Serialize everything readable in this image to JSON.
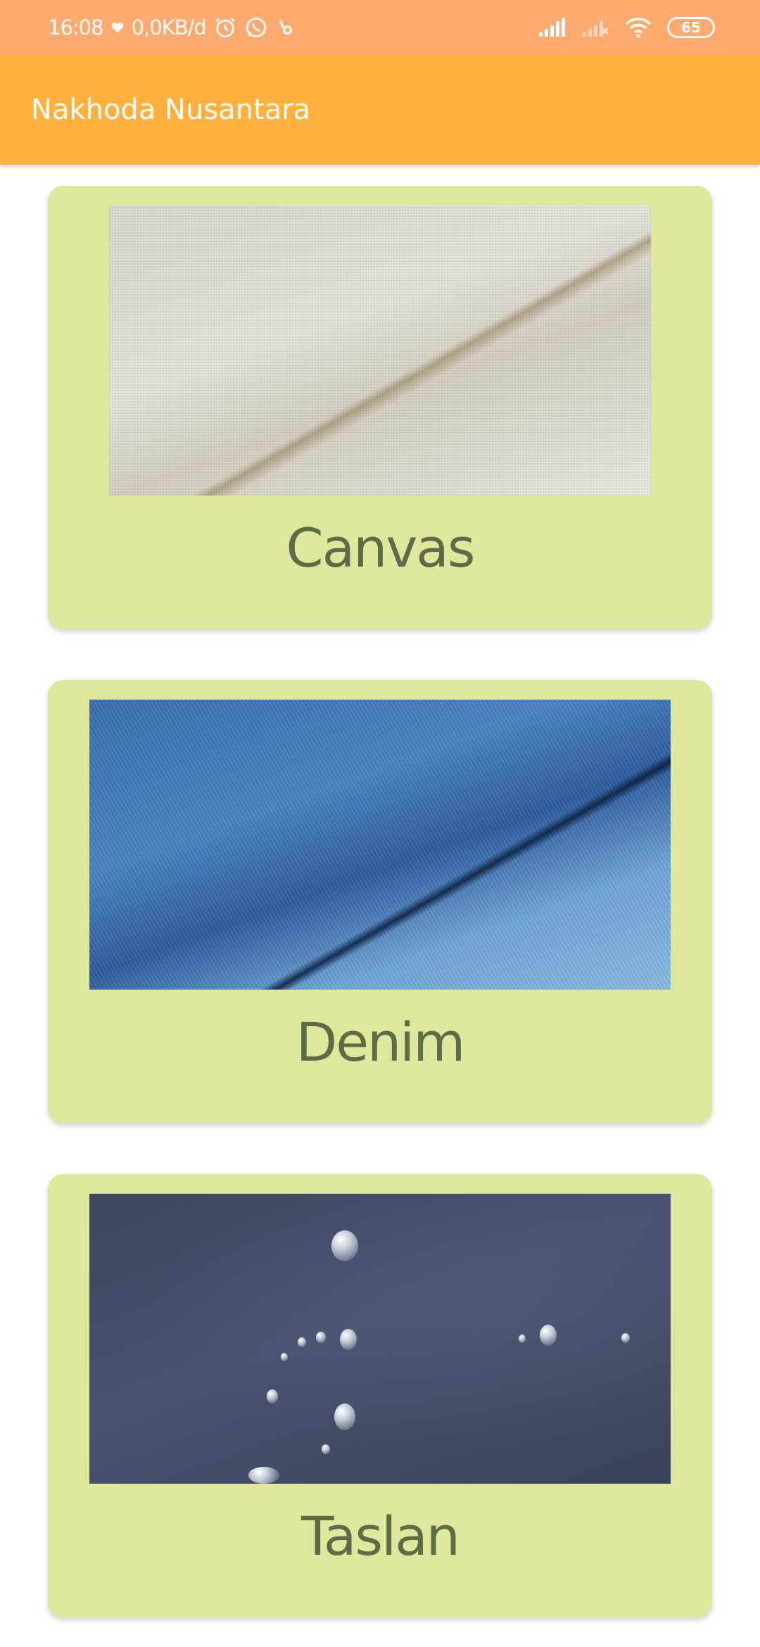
{
  "status_bar": {
    "time": "16:08",
    "data_rate": "0,0KB/d",
    "battery": "65",
    "icons": [
      "heart-icon",
      "alarm-icon",
      "whatsapp-icon",
      "notification-icon",
      "signal-icon",
      "signal-off-icon",
      "wifi-icon",
      "battery-icon"
    ]
  },
  "app_bar": {
    "title": "Nakhoda Nusantara"
  },
  "fabrics": [
    {
      "name": "Canvas",
      "image": "canvas-fabric-photo"
    },
    {
      "name": "Denim",
      "image": "denim-fabric-photo"
    },
    {
      "name": "Taslan",
      "image": "taslan-fabric-photo"
    }
  ],
  "colors": {
    "status_bar": "#fea96e",
    "app_bar": "#ffb13b",
    "card": "#dfe79d",
    "card_text": "#5f6b47"
  }
}
